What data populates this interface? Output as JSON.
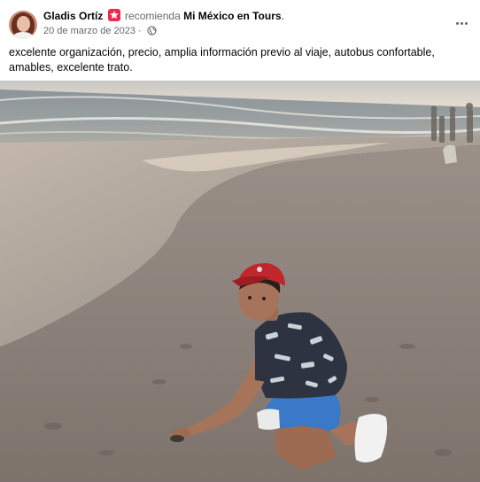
{
  "post": {
    "author": "Gladis Ortíz",
    "verb": "recomienda",
    "page_name": "Mi México en Tours",
    "period": ".",
    "date": "20 de marzo de 2023",
    "separator": "·",
    "privacy_icon": "globe-icon",
    "recommend_icon": "recommend-star-icon",
    "more_icon": "more-options-icon",
    "review_text": "excelente organización, precio, amplia información previo al viaje, autobus confortable, amables, excelente trato."
  },
  "colors": {
    "recommend_badge": "#f02849",
    "secondary_text": "#65676b",
    "primary_text": "#050505"
  }
}
